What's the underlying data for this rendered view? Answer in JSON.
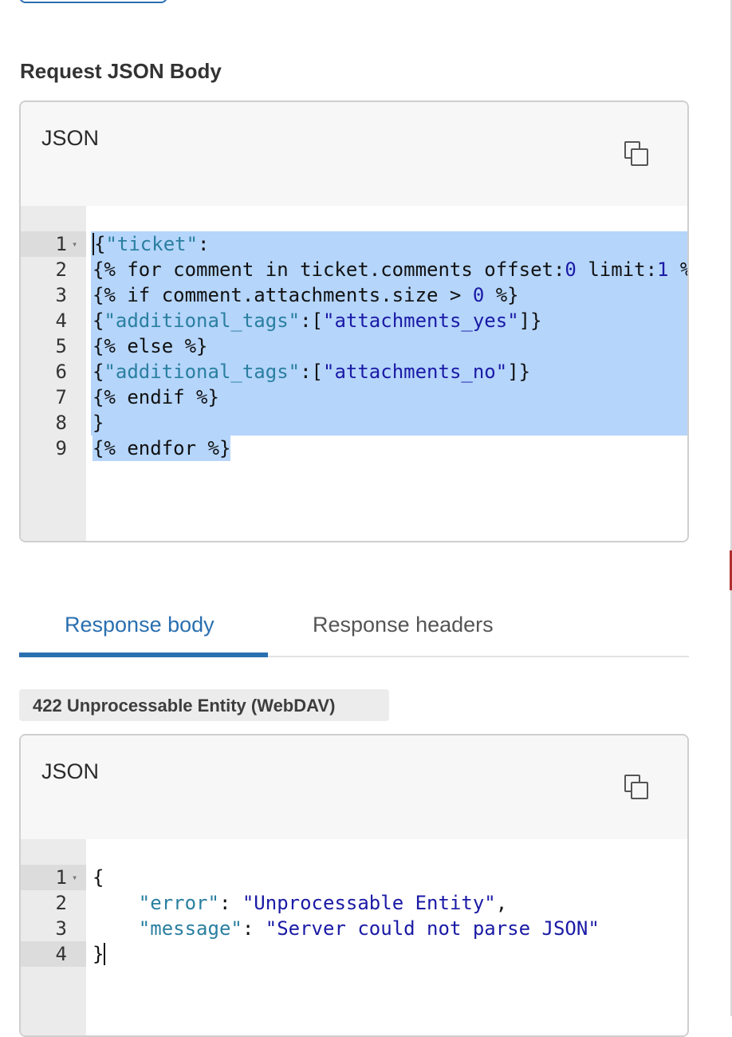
{
  "request": {
    "section_title": "Request JSON Body",
    "panel_label": "JSON",
    "copy_icon": "copy-icon",
    "lines": [
      {
        "num": "1",
        "fold": "▾",
        "tokens": [
          [
            "k",
            "{"
          ],
          [
            "s",
            "\"ticket\""
          ],
          [
            "k",
            ":"
          ]
        ]
      },
      {
        "num": "2",
        "fold": "",
        "tokens": [
          [
            "k",
            "{% for comment in ticket.comments offset:"
          ],
          [
            "n",
            "0"
          ],
          [
            "k",
            " limit:"
          ],
          [
            "n",
            "1"
          ],
          [
            "k",
            " %"
          ]
        ]
      },
      {
        "num": "3",
        "fold": "",
        "tokens": [
          [
            "k",
            "{% if comment.attachments.size > "
          ],
          [
            "n",
            "0"
          ],
          [
            "k",
            " %}"
          ]
        ]
      },
      {
        "num": "4",
        "fold": "",
        "tokens": [
          [
            "k",
            "{"
          ],
          [
            "s",
            "\"additional_tags\""
          ],
          [
            "k",
            ":["
          ],
          [
            "v",
            "\"attachments_yes\""
          ],
          [
            "k",
            "]}"
          ]
        ]
      },
      {
        "num": "5",
        "fold": "",
        "tokens": [
          [
            "k",
            "{% else %}"
          ]
        ]
      },
      {
        "num": "6",
        "fold": "",
        "tokens": [
          [
            "k",
            "{"
          ],
          [
            "s",
            "\"additional_tags\""
          ],
          [
            "k",
            ":["
          ],
          [
            "v",
            "\"attachments_no\""
          ],
          [
            "k",
            "]}"
          ]
        ]
      },
      {
        "num": "7",
        "fold": "",
        "tokens": [
          [
            "k",
            "{% endif %}"
          ]
        ]
      },
      {
        "num": "8",
        "fold": "",
        "tokens": [
          [
            "k",
            "}"
          ]
        ]
      },
      {
        "num": "9",
        "fold": "",
        "tokens": [
          [
            "k",
            "{% endfor %}"
          ]
        ]
      }
    ]
  },
  "tabs": {
    "active": "Response body",
    "inactive": "Response headers"
  },
  "status": {
    "text": "422 Unprocessable Entity (WebDAV)"
  },
  "response": {
    "panel_label": "JSON",
    "copy_icon": "copy-icon",
    "lines": [
      {
        "num": "1",
        "fold": "▾",
        "tokens": [
          [
            "k",
            "{"
          ]
        ]
      },
      {
        "num": "2",
        "fold": "",
        "tokens": [
          [
            "k",
            "    "
          ],
          [
            "s",
            "\"error\""
          ],
          [
            "k",
            ": "
          ],
          [
            "v",
            "\"Unprocessable Entity\""
          ],
          [
            "k",
            ","
          ]
        ]
      },
      {
        "num": "3",
        "fold": "",
        "tokens": [
          [
            "k",
            "    "
          ],
          [
            "s",
            "\"message\""
          ],
          [
            "k",
            ": "
          ],
          [
            "v",
            "\"Server could not parse JSON\""
          ]
        ]
      },
      {
        "num": "4",
        "fold": "",
        "tokens": [
          [
            "k",
            "}"
          ]
        ]
      }
    ]
  }
}
